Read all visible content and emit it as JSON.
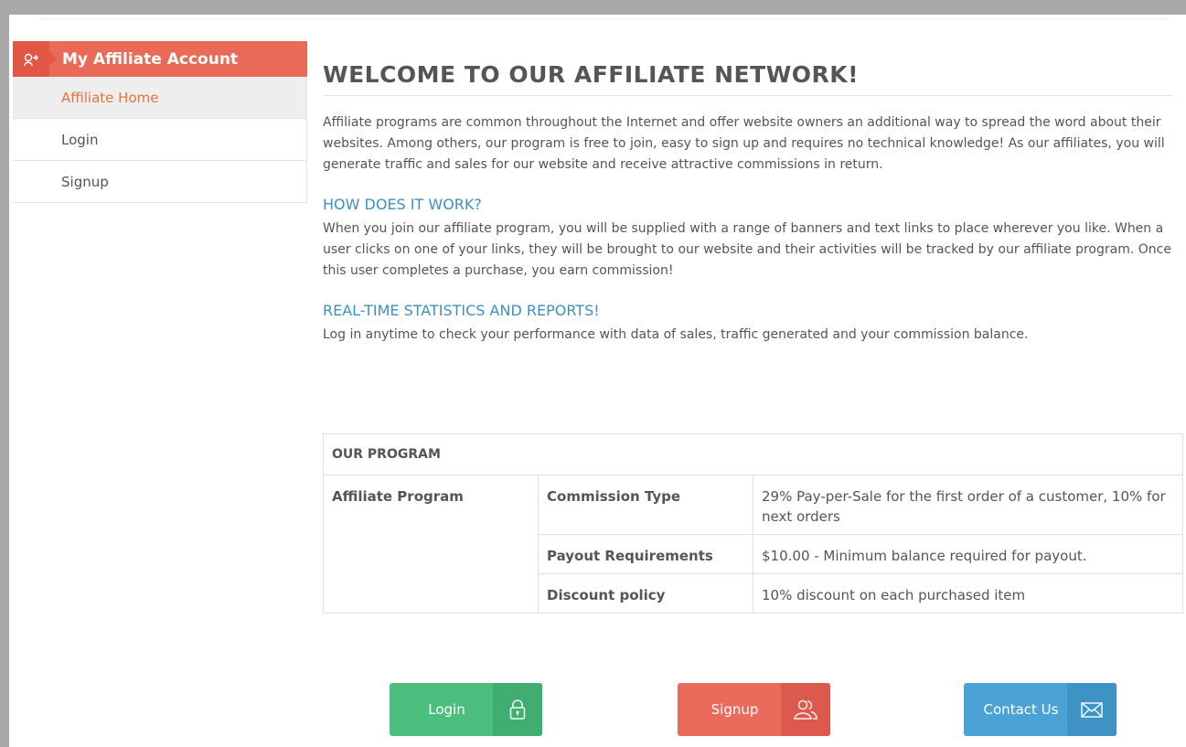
{
  "sidebar": {
    "header": {
      "label": "My Affiliate Account",
      "icon": "affiliate-icon"
    },
    "items": [
      {
        "label": "Affiliate Home",
        "active": true
      },
      {
        "label": "Login",
        "active": false
      },
      {
        "label": "Signup",
        "active": false
      }
    ]
  },
  "main": {
    "title": "WELCOME TO OUR AFFILIATE NETWORK!",
    "intro": "Affiliate programs are common throughout the Internet and offer website owners an additional way to spread the word about their websites. Among others, our program is free to join, easy to sign up and requires no technical knowledge! As our affiliates, you will generate traffic and sales for our website and receive attractive commissions in return.",
    "sections": [
      {
        "heading": "HOW DOES IT WORK?",
        "text": "When you join our affiliate program, you will be supplied with a range of banners and text links to place wherever you like. When a user clicks on one of your links, they will be brought to our website and their activities will be tracked by our affiliate program. Once this user completes a purchase, you earn commission!"
      },
      {
        "heading": "REAL-TIME STATISTICS AND REPORTS!",
        "text": "Log in anytime to check your performance with data of sales, traffic generated and your commission balance."
      }
    ]
  },
  "program_table": {
    "header": "OUR PROGRAM",
    "program_name": "Affiliate Program",
    "rows": [
      {
        "label": "Commission Type",
        "value": "29% Pay-per-Sale for the first order of a customer, 10% for next orders"
      },
      {
        "label": "Payout Requirements",
        "value": "$10.00 - Minimum balance required for payout."
      },
      {
        "label": "Discount policy",
        "value": "10% discount on each purchased item"
      }
    ]
  },
  "buttons": {
    "login": {
      "label": "Login",
      "icon": "lock-icon",
      "color": "#4cbf7e"
    },
    "signup": {
      "label": "Signup",
      "icon": "users-icon",
      "color": "#ea6a5c"
    },
    "contact": {
      "label": "Contact Us",
      "icon": "mail-icon",
      "color": "#4aa2d5"
    }
  },
  "colors": {
    "accent": "#ea6a58",
    "active_link": "#e4733a",
    "subheading": "#3f8fc2"
  }
}
